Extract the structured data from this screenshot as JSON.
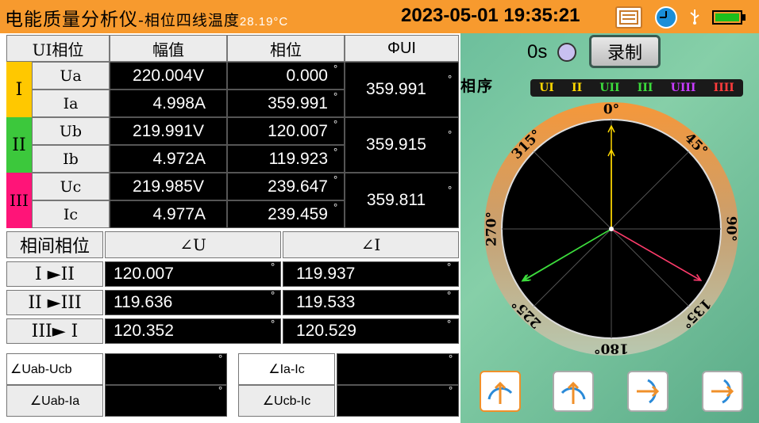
{
  "header": {
    "title_main": "电能质量分析仪",
    "title_sub": "-相位四线",
    "temp_label": "温度",
    "temp_value": "28.19",
    "temp_unit": "°C",
    "datetime": "2023-05-01 19:35:21"
  },
  "table": {
    "col_headers": [
      "UI相位",
      "幅值",
      "相位",
      "ΦUI"
    ],
    "phases": [
      {
        "name": "I",
        "color": "#ffc800",
        "rows": [
          {
            "label": "Ua",
            "amp": "220.004V",
            "phase": "0.000"
          },
          {
            "label": "Ia",
            "amp": "4.998A",
            "phase": "359.991"
          }
        ],
        "phi": "359.991"
      },
      {
        "name": "II",
        "color": "#3cc83c",
        "rows": [
          {
            "label": "Ub",
            "amp": "219.991V",
            "phase": "120.007"
          },
          {
            "label": "Ib",
            "amp": "4.972A",
            "phase": "119.923"
          }
        ],
        "phi": "359.915"
      },
      {
        "name": "III",
        "color": "#ff1478",
        "rows": [
          {
            "label": "Uc",
            "amp": "219.985V",
            "phase": "239.647"
          },
          {
            "label": "Ic",
            "amp": "4.977A",
            "phase": "239.459"
          }
        ],
        "phi": "359.811"
      }
    ],
    "degree": "°"
  },
  "interphase": {
    "title": "相间相位",
    "col_u": "∠U",
    "col_i": "∠I",
    "rows": [
      {
        "label": "I ►II",
        "u": "120.007",
        "i": "119.937"
      },
      {
        "label": "II ►III",
        "u": "119.636",
        "i": "119.533"
      },
      {
        "label": "III► I",
        "u": "120.352",
        "i": "120.529"
      }
    ]
  },
  "angles": {
    "uab_ucb": "∠Uab-Ucb",
    "uab_ia": "∠Uab-Ia",
    "ia_ic": "∠Ia-Ic",
    "ucb_ic": "∠Ucb-Ic"
  },
  "recorder": {
    "time": "0s",
    "button": "录制"
  },
  "phase_seq": {
    "label": "相序",
    "legend": [
      {
        "text": "UI",
        "color": "#ffd800"
      },
      {
        "text": "II",
        "color": "#ffd800"
      },
      {
        "text": "UII",
        "color": "#3cdc3c"
      },
      {
        "text": "III",
        "color": "#3cdc3c"
      },
      {
        "text": "UIII",
        "color": "#c83cff"
      },
      {
        "text": "IIII",
        "color": "#ff3c3c"
      }
    ]
  },
  "dial": {
    "ticks": [
      "0°",
      "45°",
      "90°",
      "135°",
      "180°",
      "225°",
      "270°",
      "315°"
    ]
  },
  "vectors": {
    "u1_deg": 0,
    "i1_deg": 359.991,
    "u2_deg": 120.007,
    "i2_deg": 119.923,
    "u3_deg": 239.647,
    "i3_deg": 239.459
  },
  "toolbar_icons": [
    "rotate-cw-arrow-icon",
    "rotate-ccw-arrow-icon",
    "curve-down-arrow-icon",
    "curve-up-arrow-icon"
  ]
}
